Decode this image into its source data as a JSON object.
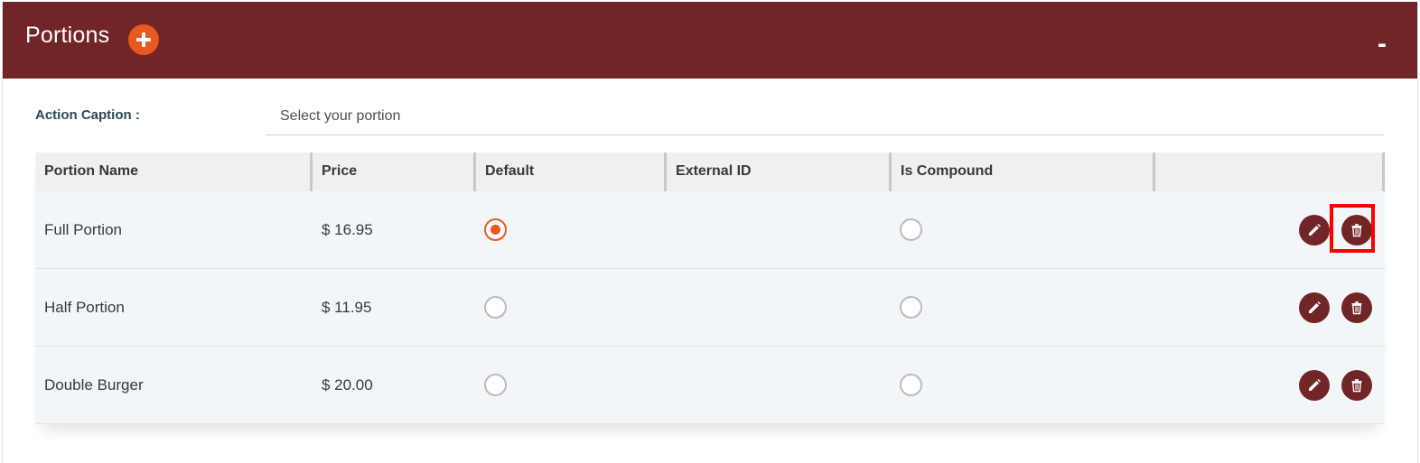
{
  "header": {
    "title": "Portions",
    "add_icon": "plus-icon",
    "collapse_label": "-"
  },
  "caption": {
    "label": "Action Caption :",
    "value": "Select your portion"
  },
  "table": {
    "columns": [
      "Portion Name",
      "Price",
      "Default",
      "External ID",
      "Is Compound",
      ""
    ],
    "rows": [
      {
        "name": "Full Portion",
        "price": "$ 16.95",
        "default": true,
        "external_id": "",
        "is_compound": false
      },
      {
        "name": "Half Portion",
        "price": "$ 11.95",
        "default": false,
        "external_id": "",
        "is_compound": false
      },
      {
        "name": "Double Burger",
        "price": "$ 20.00",
        "default": false,
        "external_id": "",
        "is_compound": false
      }
    ],
    "row_actions": [
      "pencil-icon",
      "trash-icon"
    ]
  },
  "colors": {
    "header_bg": "#722527",
    "accent": "#e8591f",
    "action_button": "#722527",
    "highlight": "#ff0000"
  }
}
